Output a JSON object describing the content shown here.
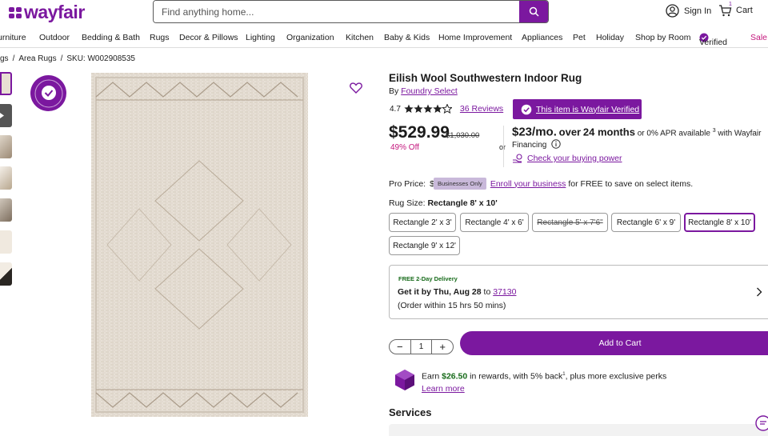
{
  "header": {
    "logo": "wayfair",
    "search_placeholder": "Find anything home...",
    "sign_in": "Sign In",
    "cart_label": "Cart",
    "cart_count": "1"
  },
  "nav": {
    "items": [
      "urniture",
      "Outdoor",
      "Bedding & Bath",
      "Rugs",
      "Decor & Pillows",
      "Lighting",
      "Organization",
      "Kitchen",
      "Baby & Kids",
      "Home Improvement",
      "Appliances",
      "Pet",
      "Holiday",
      "Shop by Room"
    ],
    "verified": "Verified",
    "sale": "Sale"
  },
  "breadcrumb": {
    "first": "gs",
    "second": "Area Rugs",
    "sku": "SKU: W002908535"
  },
  "product": {
    "title": "Eilish Wool Southwestern Indoor Rug",
    "by_prefix": "By",
    "brand": "Foundry Select",
    "rating": "4.7",
    "reviews": "36 Reviews",
    "verified_label": "This item is Wayfair Verified",
    "price": "$529.99",
    "was_price": "$1,030.00",
    "discount": "49% Off",
    "or": "or",
    "financing_monthly": "$23/mo.",
    "financing_over": "over",
    "financing_months": "24 months",
    "financing_or": "or",
    "financing_apr": "0% APR",
    "financing_rest": "available",
    "financing_sup": "3",
    "financing_with": "with Wayfair Financing",
    "check_power": "Check your buying power",
    "pro_price_label": "Pro Price:",
    "pro_price_value": "$",
    "businesses_only": "Businesses Only",
    "enroll": "Enroll your business",
    "enroll_rest": "for FREE to save on select items.",
    "size_label": "Rug Size:",
    "size_selected": "Rectangle 8' x 10'",
    "sizes": [
      "Rectangle 2' x 3'",
      "Rectangle 4' x 6'",
      "Rectangle 5' x 7'6\"",
      "Rectangle 6' x 9'",
      "Rectangle 8' x 10'",
      "Rectangle 9' x 12'"
    ]
  },
  "delivery": {
    "tag": "FREE 2-Day Delivery",
    "get_it": "Get it by Thu, Aug 28",
    "to": "to",
    "zip": "37130",
    "cutoff": "(Order within 15 hrs 50 mins)"
  },
  "purchase": {
    "minus": "−",
    "quantity": "1",
    "plus": "+",
    "add_to_cart": "Add to Cart"
  },
  "rewards": {
    "earn": "Earn",
    "amount": "$26.50",
    "rest": "in rewards, with 5% back",
    "sup": "1",
    "perks": ", plus more exclusive perks",
    "learn_more": "Learn more"
  },
  "services_title": "Services",
  "colors": {
    "brand": "#7b189f",
    "sale": "#c4177d",
    "delivery_green": "#176b1a"
  }
}
